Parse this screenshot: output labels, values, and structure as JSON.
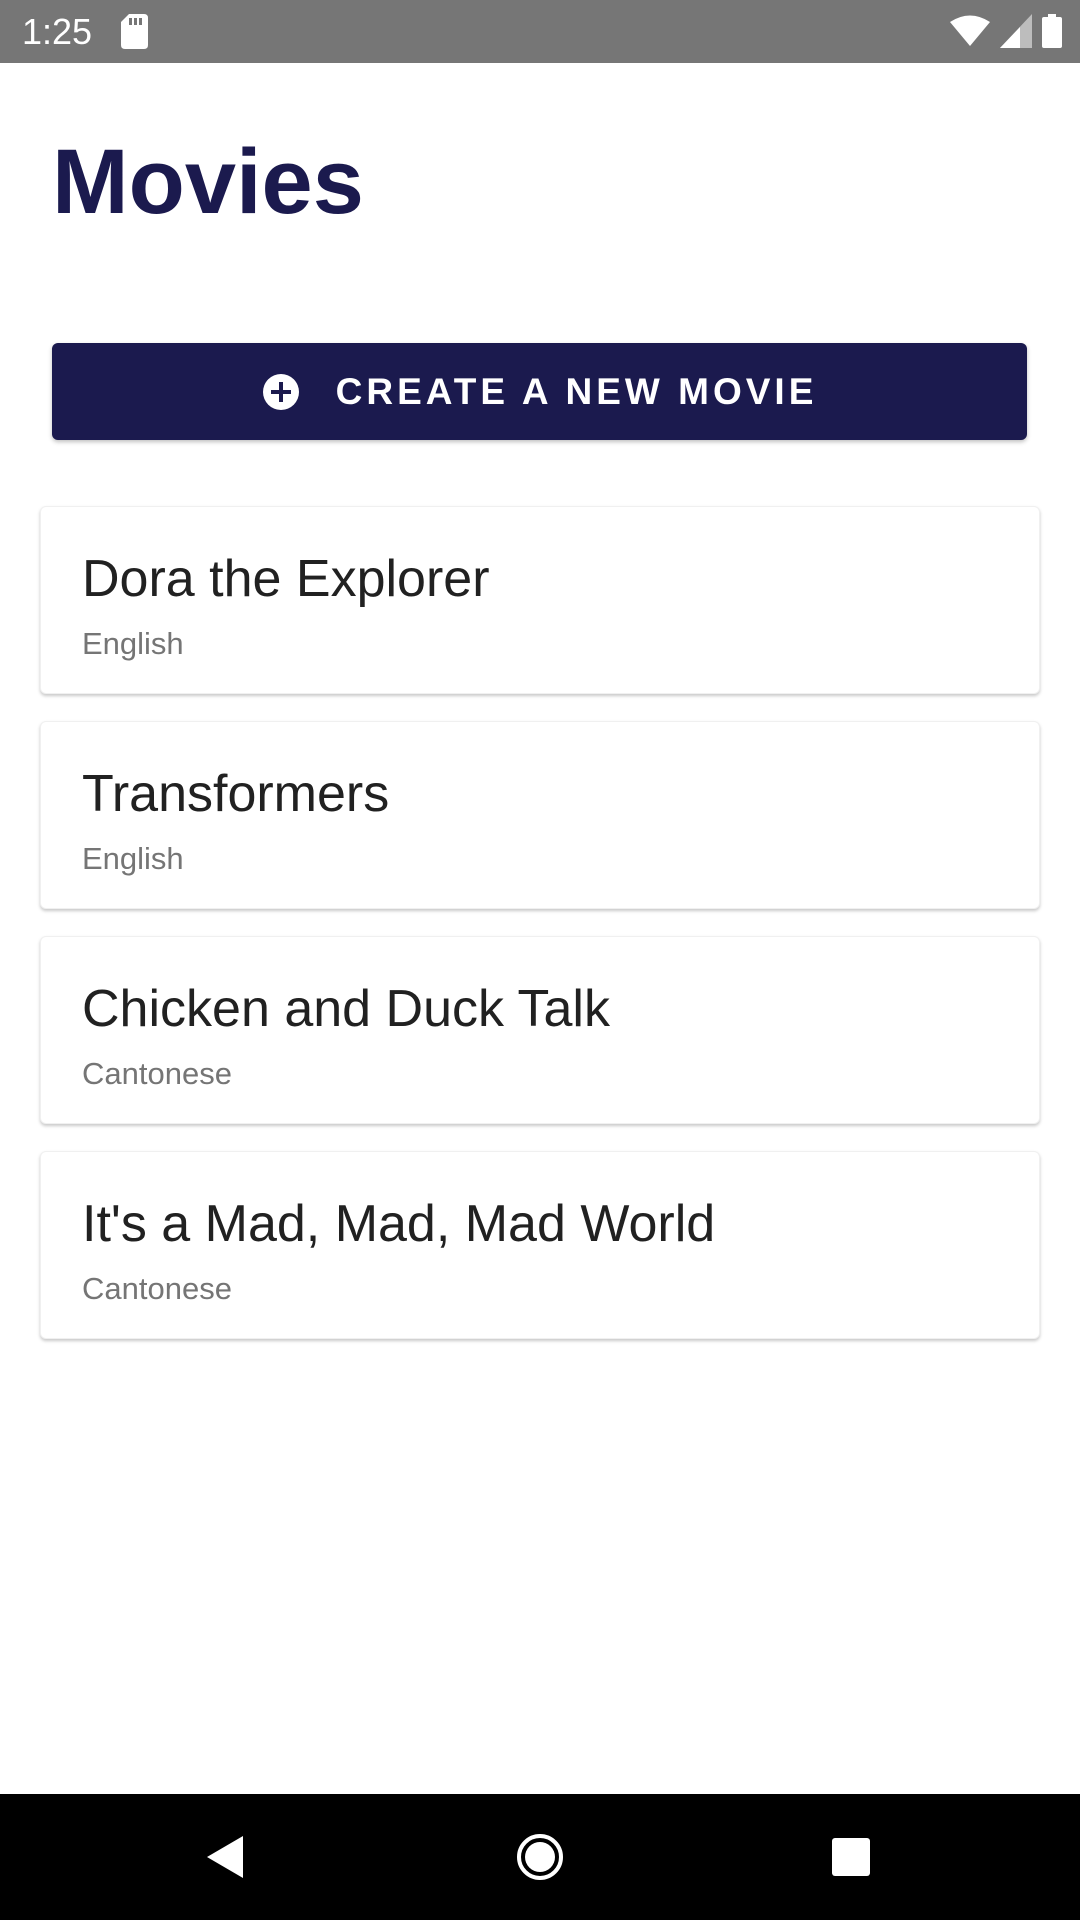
{
  "status_bar": {
    "time": "1:25",
    "background": "#767676",
    "icons": [
      "sd-card-icon",
      "wifi-icon",
      "cell-signal-icon",
      "battery-icon"
    ]
  },
  "header": {
    "title": "Movies",
    "title_color": "#1b1a4e"
  },
  "create_button": {
    "label": "CREATE A NEW MOVIE",
    "icon": "add-circle-icon",
    "background": "#1b1a4e"
  },
  "movies": [
    {
      "title": "Dora the Explorer",
      "language": "English"
    },
    {
      "title": "Transformers",
      "language": "English"
    },
    {
      "title": "Chicken and Duck Talk",
      "language": "Cantonese"
    },
    {
      "title": "It's a Mad, Mad, Mad World",
      "language": "Cantonese"
    }
  ],
  "nav_bar": {
    "buttons": [
      "back-icon",
      "home-icon",
      "recents-icon"
    ]
  }
}
